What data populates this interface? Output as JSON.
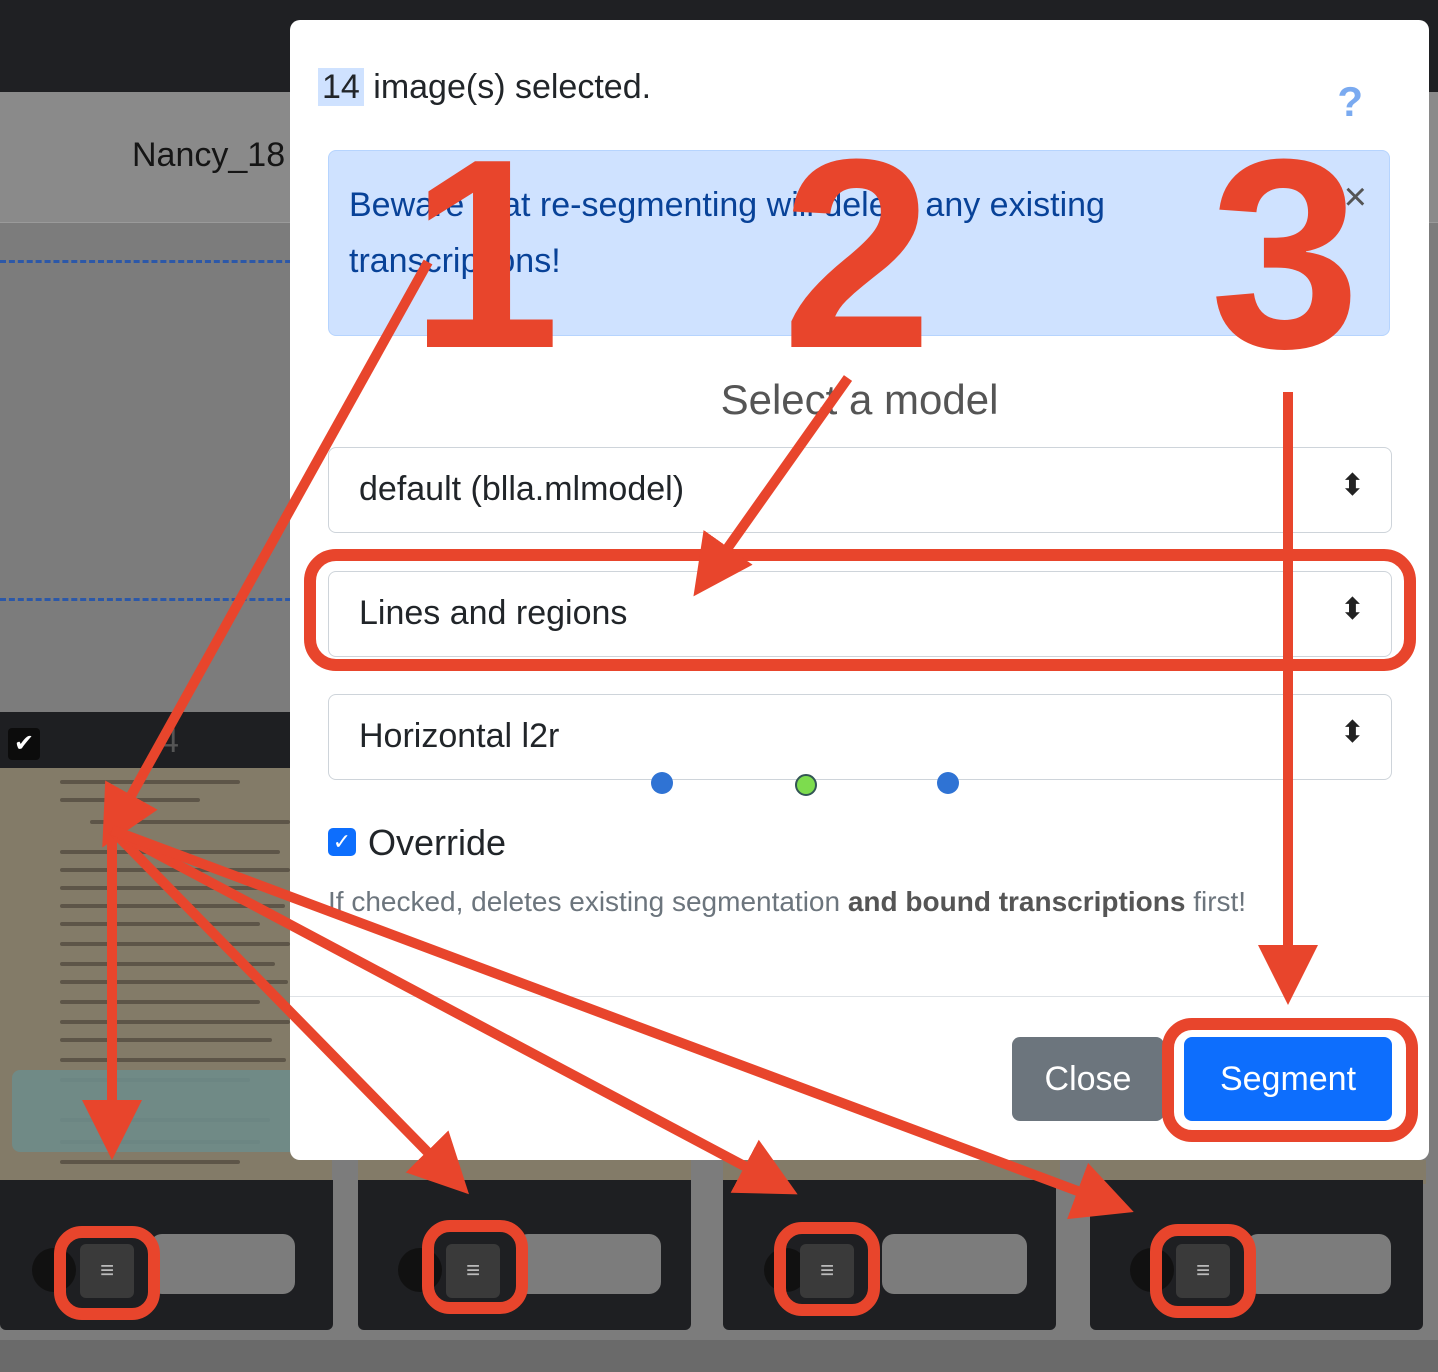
{
  "document": {
    "title": "Nancy_18"
  },
  "card": {
    "number": "4",
    "checked_glyph": "✔",
    "segment_icon": "≡"
  },
  "modal": {
    "selected_count": "14",
    "selected_suffix": " image(s) selected.",
    "help_glyph": "?",
    "alert_text": "Beware that re-segmenting will delete any existing transcriptions!",
    "alert_close": "×",
    "heading": "Select a model",
    "model_select": "default (blla.mlmodel)",
    "steps_select": "Lines and regions",
    "direction_select": "Horizontal l2r",
    "override_label": "Override",
    "override_checked": true,
    "override_help_before": "If checked, deletes existing segmentation ",
    "override_help_bold": "and bound transcriptions",
    "override_help_after": " first!",
    "close_button": "Close",
    "segment_button": "Segment",
    "select_caret": "⬍"
  },
  "annotations": {
    "step1": "1",
    "step2": "2",
    "step3": "3",
    "color": "#e8452c"
  }
}
